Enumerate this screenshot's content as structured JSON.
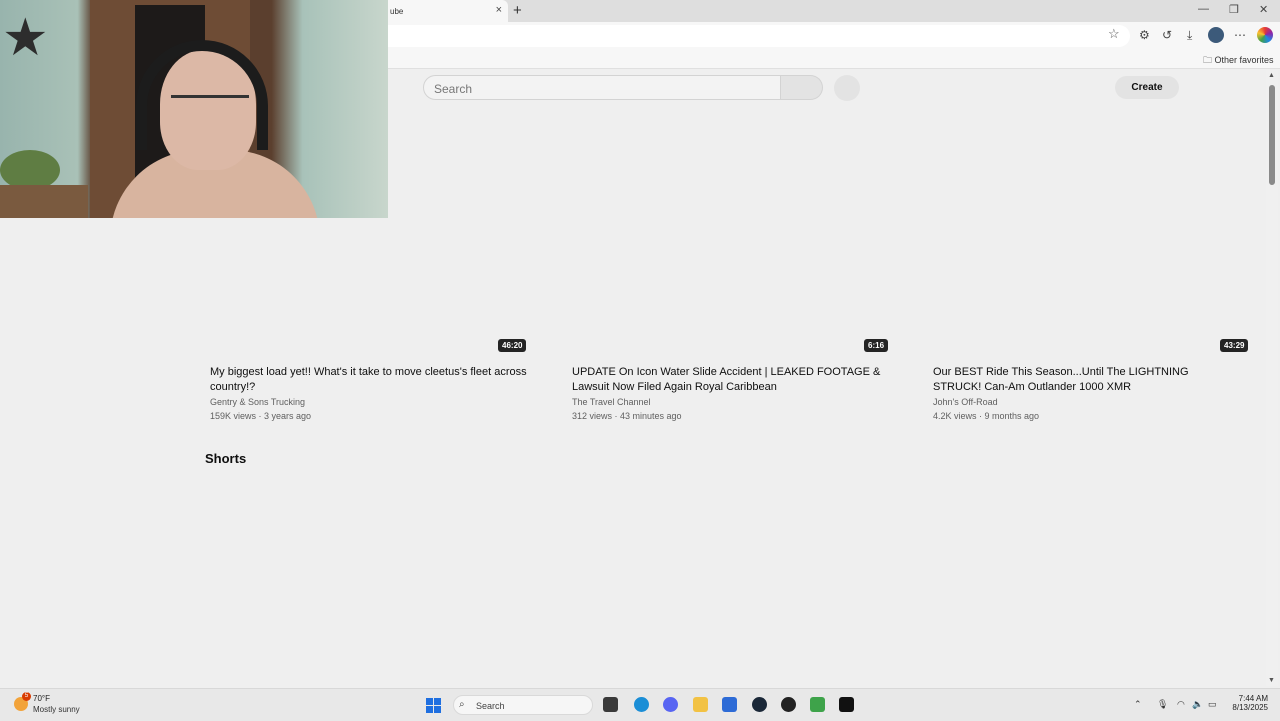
{
  "browser": {
    "tab_title": "ube",
    "tab_close": "×",
    "new_tab": "+",
    "favorites_label": "Other favorites"
  },
  "youtube": {
    "search_placeholder": "Search",
    "create_label": "Create",
    "shorts_heading": "Shorts",
    "videos": [
      {
        "duration": "46:20",
        "title": "My biggest load yet!! What's it take to move cleetus's fleet across country!?",
        "channel": "Gentry & Sons Trucking",
        "stats": "159K views · 3 years ago"
      },
      {
        "duration": "6:16",
        "title": "UPDATE On Icon Water Slide Accident | LEAKED FOOTAGE & Lawsuit Now Filed Again Royal Caribbean",
        "channel": "The Travel Channel",
        "stats": "312 views · 43 minutes ago"
      },
      {
        "duration": "43:29",
        "title": "Our BEST Ride This Season...Until The LIGHTNING STRUCK! Can-Am Outlander 1000 XMR",
        "channel": "John's Off-Road",
        "stats": "4.2K views · 9 months ago"
      }
    ]
  },
  "taskbar": {
    "weather_badge": "5",
    "temperature": "70°F",
    "condition": "Mostly sunny",
    "search_label": "Search",
    "time": "7:44 AM",
    "date": "8/13/2025"
  },
  "icons": [
    "star-icon",
    "history-icon",
    "download-icon",
    "more-icon",
    "folder-icon",
    "search-icon",
    "mic-icon",
    "windows-icon",
    "discord-icon",
    "steam-icon",
    "edge-icon",
    "file-explorer-icon",
    "store-icon",
    "nvidia-icon"
  ]
}
